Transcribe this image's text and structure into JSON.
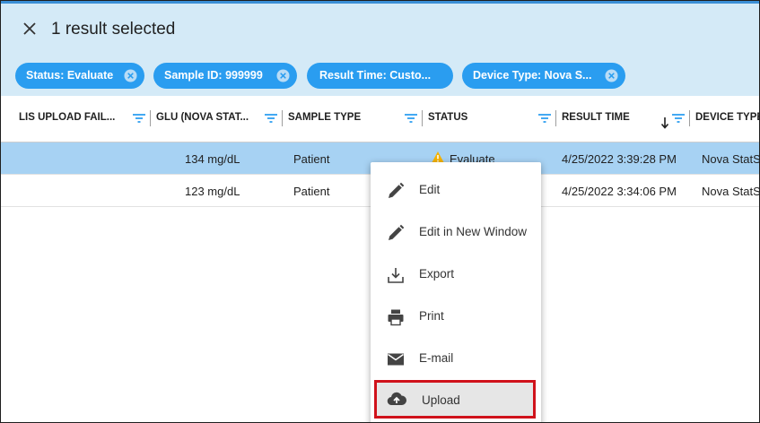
{
  "selection": {
    "text": "1 result selected"
  },
  "filters": [
    {
      "label": "Status: Evaluate"
    },
    {
      "label": "Sample ID: 999999"
    },
    {
      "label": "Result Time: Custo..."
    },
    {
      "label": "Device Type: Nova S..."
    }
  ],
  "columns": [
    {
      "label": "LIS UPLOAD FAIL..."
    },
    {
      "label": "GLU (NOVA STAT..."
    },
    {
      "label": "SAMPLE TYPE"
    },
    {
      "label": "STATUS"
    },
    {
      "label": "RESULT TIME"
    },
    {
      "label": "DEVICE TYPE"
    }
  ],
  "rows": [
    {
      "glu": "134 mg/dL",
      "sample_type": "Patient",
      "status": "Evaluate",
      "result_time": "4/25/2022 3:39:28 PM",
      "device": "Nova StatStrip"
    },
    {
      "glu": "123 mg/dL",
      "sample_type": "Patient",
      "status": "",
      "result_time": "4/25/2022 3:34:06 PM",
      "device": "Nova StatStrip"
    }
  ],
  "context_menu": {
    "items": [
      {
        "label": "Edit",
        "icon": "pencil-icon"
      },
      {
        "label": "Edit in New Window",
        "icon": "pencil-icon"
      },
      {
        "label": "Export",
        "icon": "download-tray-icon"
      },
      {
        "label": "Print",
        "icon": "printer-icon"
      },
      {
        "label": "E-mail",
        "icon": "envelope-icon"
      },
      {
        "label": "Upload",
        "icon": "cloud-upload-icon"
      }
    ]
  },
  "colors": {
    "accent": "#2a9df0",
    "selection_bg": "#d4eaf7",
    "selected_row": "#a7d2f3",
    "highlight_border": "#d0121b",
    "warning": "#f6b300"
  }
}
